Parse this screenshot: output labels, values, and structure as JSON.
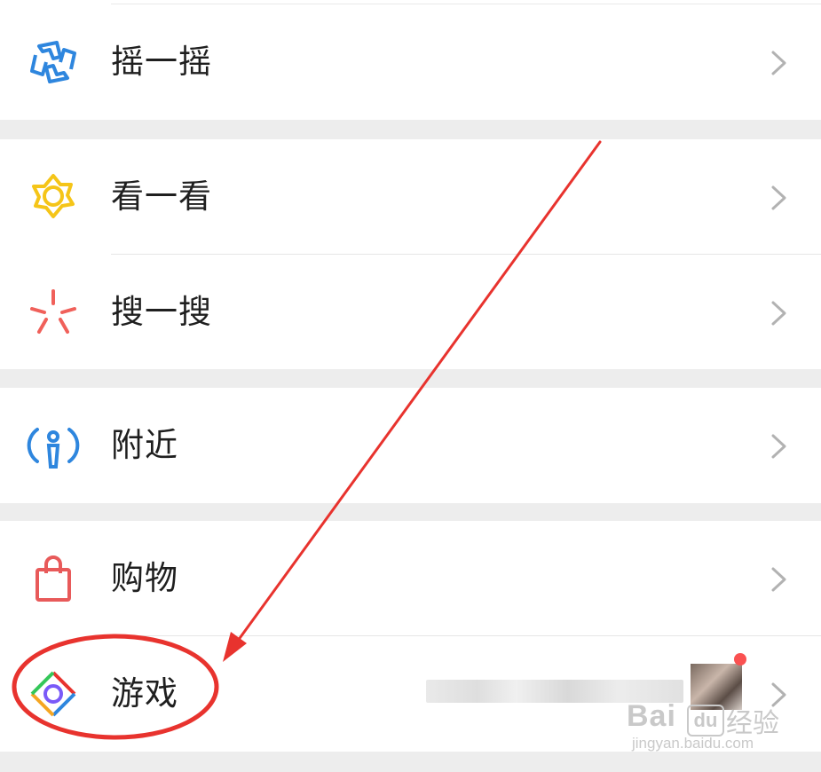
{
  "menu": {
    "items": [
      {
        "label": "摇一摇",
        "icon": "shake-icon"
      },
      {
        "label": "看一看",
        "icon": "top-stories-icon"
      },
      {
        "label": "搜一搜",
        "icon": "search-spark-icon"
      },
      {
        "label": "附近",
        "icon": "nearby-icon"
      },
      {
        "label": "购物",
        "icon": "shopping-bag-icon"
      },
      {
        "label": "游戏",
        "icon": "games-icon"
      }
    ]
  },
  "colors": {
    "shake_icon": "#2e86de",
    "top_stories_icon": "#f5c518",
    "search_icon": "#f0605a",
    "nearby_icon": "#2e86de",
    "shopping_icon": "#e85a5a",
    "annotation_red": "#e8332e",
    "badge_red": "#fa5151"
  },
  "watermark": {
    "main": "Bai",
    "du": "du",
    "cn": "经验",
    "sub": "jingyan.baidu.com"
  }
}
